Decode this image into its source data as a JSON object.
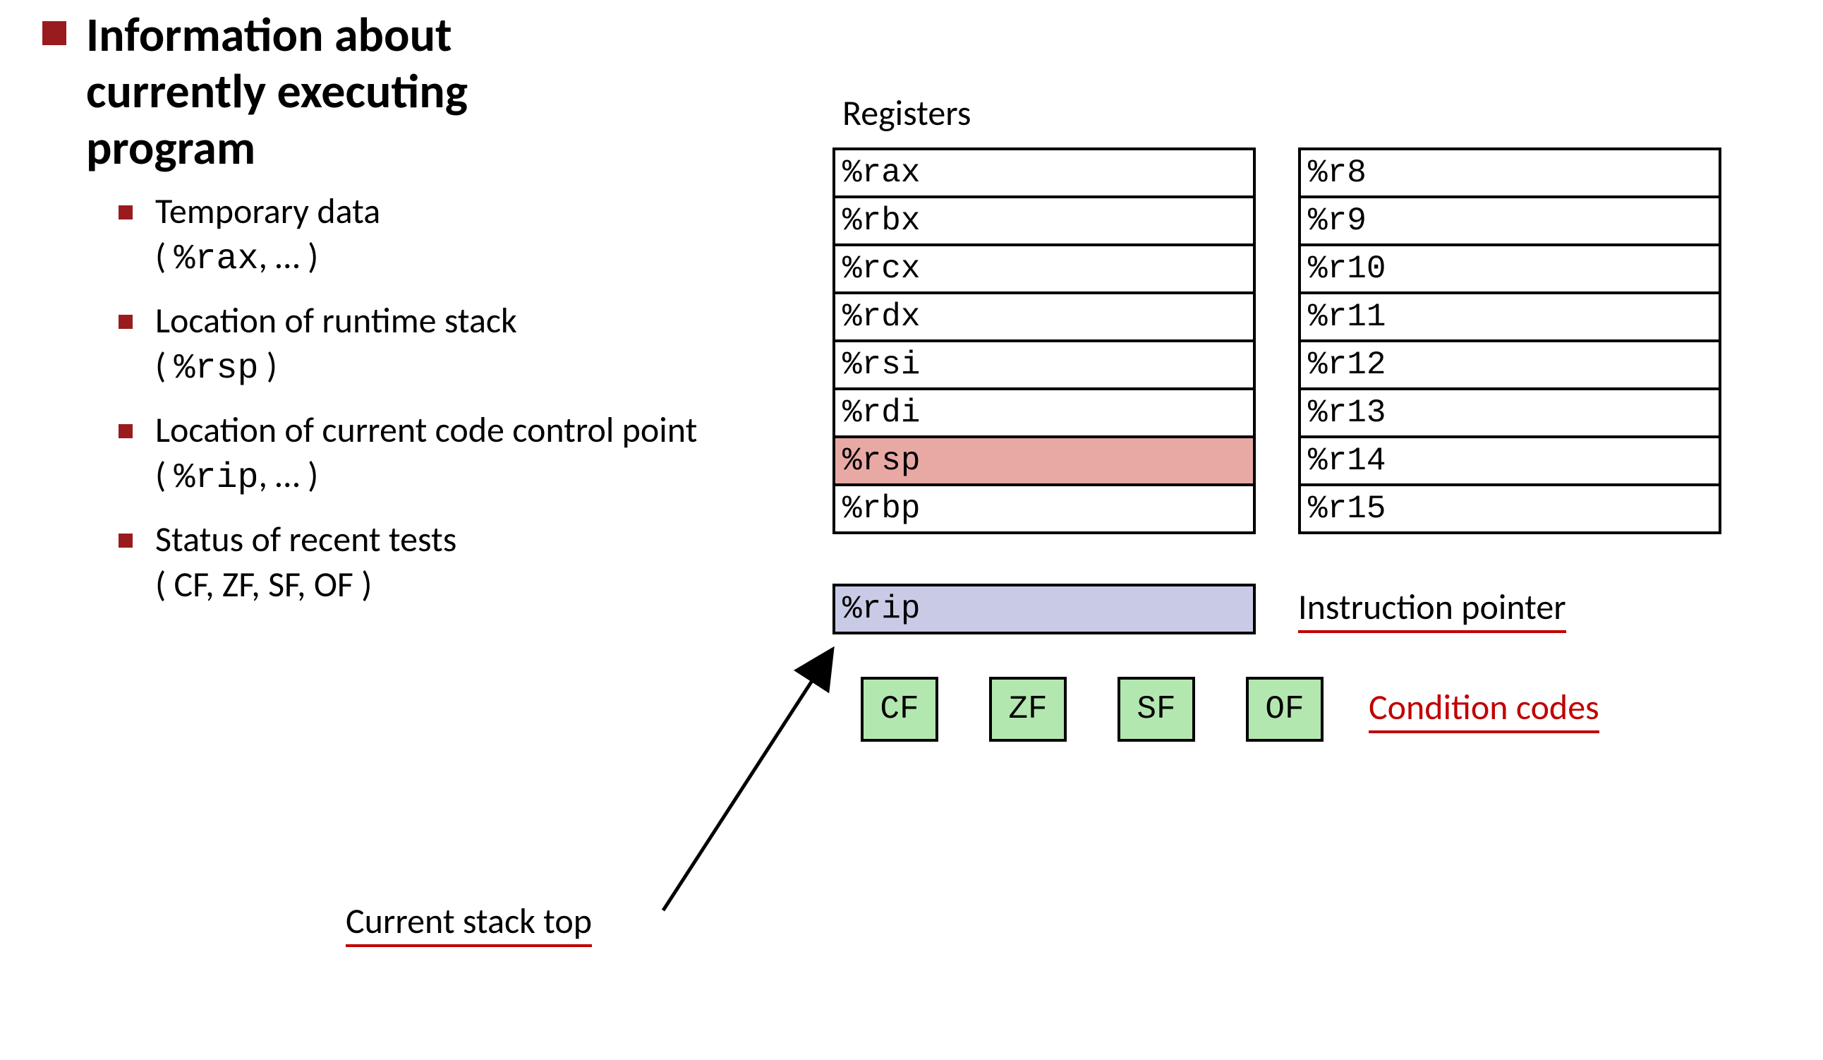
{
  "left": {
    "title_line1": "Information about",
    "title_line2": "currently executing",
    "title_line3": "program",
    "items": [
      {
        "label": "Temporary data",
        "detail_prefix": "( ",
        "detail_mono": "%rax",
        "detail_suffix": ", … )"
      },
      {
        "label": "Location of runtime stack",
        "detail_prefix": "( ",
        "detail_mono": "%rsp",
        "detail_suffix": " )"
      },
      {
        "label": "Location of current code control point",
        "detail_prefix": "( ",
        "detail_mono": "%rip",
        "detail_suffix": ", … )"
      },
      {
        "label": "Status of recent tests",
        "detail_prefix": "( CF, ZF, SF, OF )",
        "detail_mono": "",
        "detail_suffix": ""
      }
    ]
  },
  "right": {
    "registers_heading": "Registers",
    "col1": [
      "%rax",
      "%rbx",
      "%rcx",
      "%rdx",
      "%rsi",
      "%rdi",
      "%rsp",
      "%rbp"
    ],
    "col2": [
      "%r8",
      "%r9",
      "%r10",
      "%r11",
      "%r12",
      "%r13",
      "%r14",
      "%r15"
    ],
    "rip": "%rip",
    "ip_label": "Instruction pointer",
    "flags": [
      "CF",
      "ZF",
      "SF",
      "OF"
    ],
    "cc_label": "Condition codes"
  },
  "annotations": {
    "current_stack_top": "Current stack top"
  }
}
